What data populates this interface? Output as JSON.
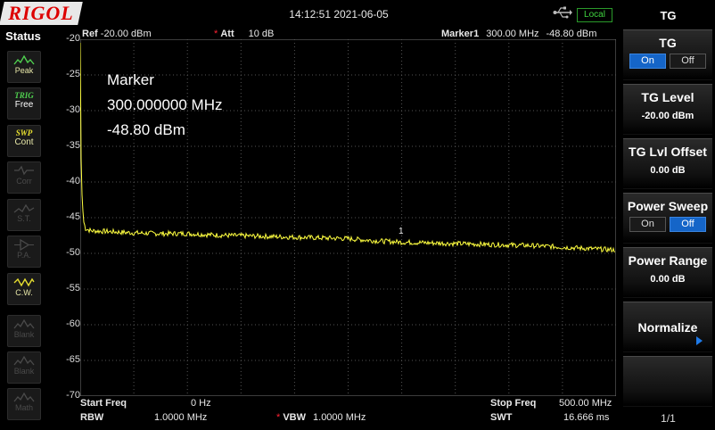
{
  "brand": "RIGOL",
  "datetime": "14:12:51 2021-06-05",
  "local_badge": "Local",
  "status": {
    "title": "Status",
    "buttons": [
      {
        "top": "TRIG",
        "bottom": "Free"
      },
      {
        "top": "SWP",
        "bottom": "Cont"
      },
      {
        "label": "Peak"
      },
      {
        "label": "Corr"
      },
      {
        "label": "S.T."
      },
      {
        "label": "P.A."
      },
      {
        "label": "C.W."
      },
      {
        "label": "Blank"
      },
      {
        "label": "Blank"
      },
      {
        "label": "Math"
      }
    ]
  },
  "header": {
    "ref_label": "Ref",
    "ref_value": "-20.00 dBm",
    "att_mark": "*",
    "att_label": "Att",
    "att_value": "10 dB",
    "marker_label": "Marker1",
    "marker_freq": "300.00 MHz",
    "marker_amp": "-48.80 dBm"
  },
  "marker_readout": {
    "title": "Marker",
    "freq": "300.000000 MHz",
    "amp": "-48.80 dBm"
  },
  "footer": {
    "start_label": "Start Freq",
    "start_value": "0 Hz",
    "stop_label": "Stop Freq",
    "stop_value": "500.00 MHz",
    "rbw_label": "RBW",
    "rbw_value": "1.0000 MHz",
    "vbw_mark": "*",
    "vbw_label": "VBW",
    "vbw_value": "1.0000 MHz",
    "swt_label": "SWT",
    "swt_value": "16.666 ms"
  },
  "chart_data": {
    "type": "line",
    "y_ticks": [
      "-20",
      "-25",
      "-30",
      "-35",
      "-40",
      "-45",
      "-50",
      "-55",
      "-60",
      "-65",
      "-70"
    ],
    "ylim": [
      -70,
      -20
    ],
    "xlim": [
      0,
      500
    ],
    "x_unit": "MHz",
    "y_unit": "dBm",
    "grid": true,
    "trace_color": "#ffff40",
    "series": [
      {
        "x": [
          0,
          1,
          3,
          5,
          10,
          25,
          50,
          75,
          100,
          125,
          150,
          175,
          200,
          225,
          250,
          275,
          300,
          325,
          350,
          375,
          400,
          425,
          450,
          475,
          500
        ],
        "values": [
          -20.5,
          -40,
          -45.5,
          -46.6,
          -46.9,
          -47.0,
          -47.2,
          -47.3,
          -47.3,
          -47.5,
          -47.6,
          -47.7,
          -47.8,
          -47.9,
          -48.0,
          -48.3,
          -48.5,
          -48.6,
          -48.7,
          -48.8,
          -48.9,
          -49.0,
          -49.2,
          -49.4,
          -49.6
        ]
      }
    ],
    "marker": {
      "label": "1",
      "x": 300,
      "y": -48.8
    }
  },
  "menu": {
    "title": "TG",
    "keys": [
      {
        "title": "TG",
        "on": "On",
        "off": "Off",
        "selected": "On"
      },
      {
        "title": "TG Level",
        "value": "-20.00 dBm"
      },
      {
        "title": "TG Lvl Offset",
        "value": "0.00 dB"
      },
      {
        "title": "Power Sweep",
        "on": "On",
        "off": "Off",
        "selected": "Off"
      },
      {
        "title": "Power Range",
        "value": "0.00 dB"
      },
      {
        "title": "Normalize"
      }
    ],
    "page": "1/1"
  }
}
